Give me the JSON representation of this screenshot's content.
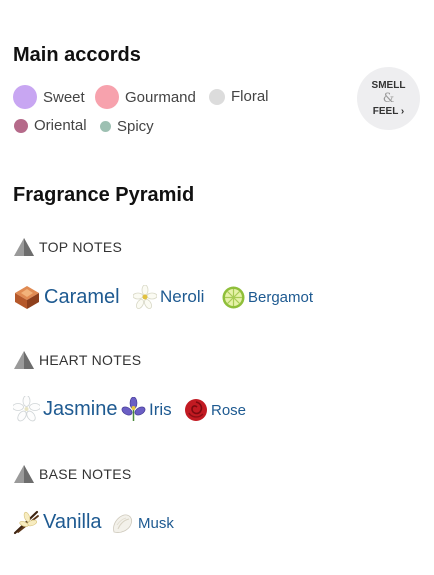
{
  "accords": {
    "title": "Main accords",
    "items": [
      {
        "label": "Sweet",
        "color": "#c8a6f2"
      },
      {
        "label": "Gourmand",
        "color": "#f7a2ad"
      },
      {
        "label": "Floral",
        "color": "#dcdcdc"
      },
      {
        "label": "Oriental",
        "color": "#b56a8a"
      },
      {
        "label": "Spicy",
        "color": "#9dc0b2"
      }
    ]
  },
  "smell_feel": {
    "line1": "SMELL",
    "amp": "&",
    "line2": "FEEL ›"
  },
  "pyramid": {
    "title": "Fragrance Pyramid",
    "top": {
      "label": "TOP NOTES",
      "notes": [
        "Caramel",
        "Neroli",
        "Bergamot"
      ]
    },
    "heart": {
      "label": "HEART NOTES",
      "notes": [
        "Jasmine",
        "Iris",
        "Rose"
      ]
    },
    "base": {
      "label": "BASE NOTES",
      "notes": [
        "Vanilla",
        "Musk"
      ]
    }
  }
}
